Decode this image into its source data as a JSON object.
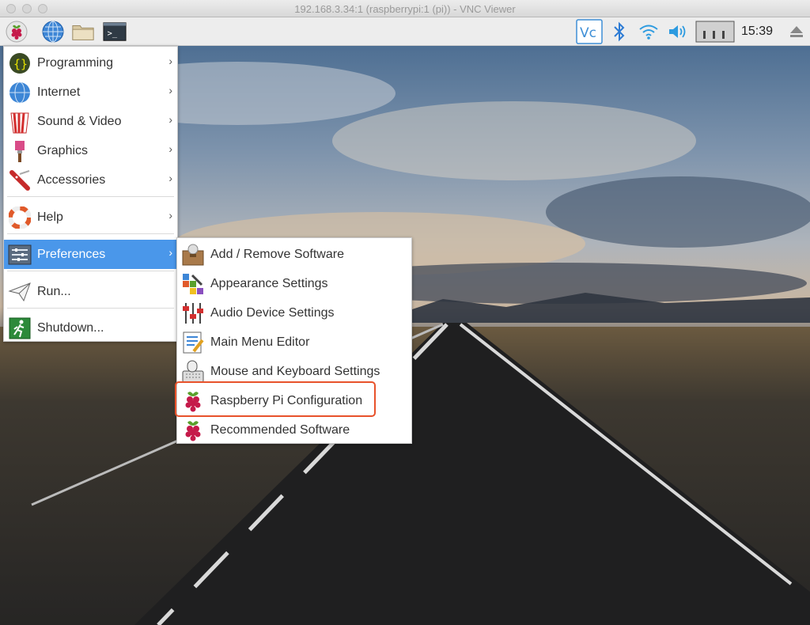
{
  "window": {
    "title": "192.168.3.34:1 (raspberrypi:1 (pi)) - VNC Viewer"
  },
  "taskbar": {
    "launchers": [
      "raspberry-icon",
      "globe-icon",
      "folder-icon",
      "terminal-icon"
    ],
    "tray": [
      "vnc-icon",
      "bluetooth-icon",
      "wifi-icon",
      "volume-icon",
      "cpu-monitor-icon",
      "eject-icon"
    ],
    "clock": "15:39"
  },
  "main_menu": {
    "items": [
      {
        "label": "Programming",
        "icon": "programming-icon",
        "submenu": true
      },
      {
        "label": "Internet",
        "icon": "globe-icon",
        "submenu": true
      },
      {
        "label": "Sound & Video",
        "icon": "popcorn-icon",
        "submenu": true
      },
      {
        "label": "Graphics",
        "icon": "paintbrush-icon",
        "submenu": true
      },
      {
        "label": "Accessories",
        "icon": "knife-icon",
        "submenu": true
      },
      {
        "label": "Help",
        "icon": "lifebuoy-icon",
        "submenu": true
      },
      {
        "label": "Preferences",
        "icon": "preferences-icon",
        "submenu": true,
        "selected": true
      },
      {
        "label": "Run...",
        "icon": "paper-plane-icon",
        "submenu": false
      },
      {
        "label": "Shutdown...",
        "icon": "exit-icon",
        "submenu": false
      }
    ]
  },
  "preferences_menu": {
    "items": [
      {
        "label": "Add / Remove Software",
        "icon": "package-icon"
      },
      {
        "label": "Appearance Settings",
        "icon": "appearance-icon"
      },
      {
        "label": "Audio Device Settings",
        "icon": "mixer-icon"
      },
      {
        "label": "Main Menu Editor",
        "icon": "menu-editor-icon"
      },
      {
        "label": "Mouse and Keyboard Settings",
        "icon": "keyboard-mouse-icon"
      },
      {
        "label": "Raspberry Pi Configuration",
        "icon": "raspberry-icon",
        "highlighted": true
      },
      {
        "label": "Recommended Software",
        "icon": "raspberry-icon"
      }
    ]
  },
  "colors": {
    "selection": "#4a97ea",
    "highlight_border": "#e8522b",
    "raspberry_red": "#c51a4a"
  }
}
